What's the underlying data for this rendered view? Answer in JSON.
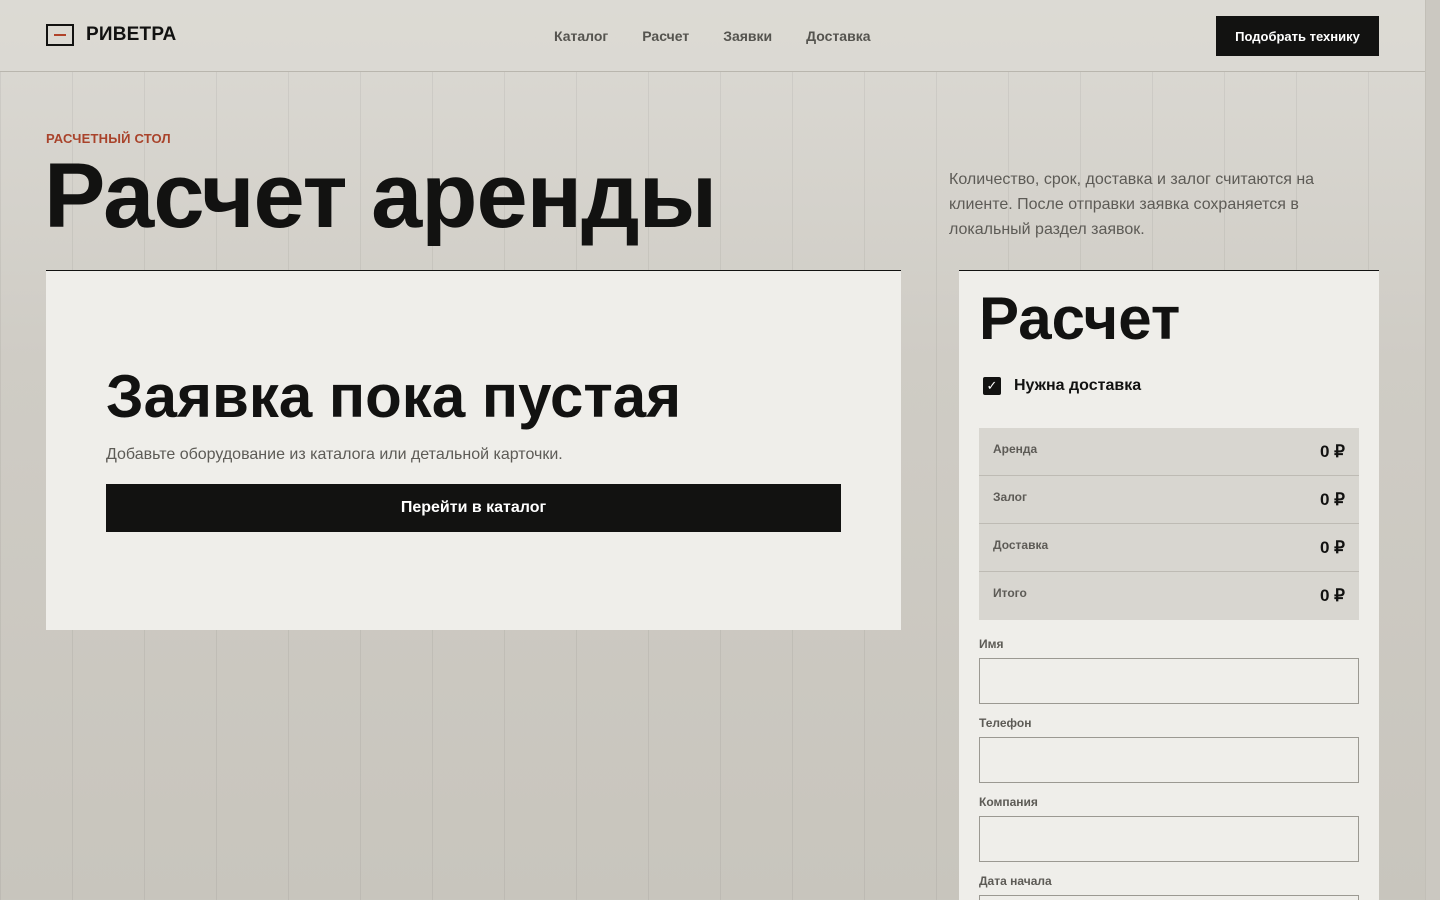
{
  "header": {
    "brand": "РИВЕТРА",
    "nav": [
      "Каталог",
      "Расчет",
      "Заявки",
      "Доставка"
    ],
    "cta_label": "Подобрать технику"
  },
  "hero": {
    "eyebrow": "РАСЧЕТНЫЙ СТОЛ",
    "title": "Расчет аренды",
    "description": "Количество, срок, доставка и залог считаются на клиенте. После отправки заявка сохраняется в локальный раздел заявок."
  },
  "empty_state": {
    "title": "Заявка пока пустая",
    "text": "Добавьте оборудование из каталога или детальной карточки.",
    "button_label": "Перейти в каталог"
  },
  "calculator": {
    "title": "Расчет",
    "delivery_label": "Нужна доставка",
    "delivery_checked": true,
    "summary": [
      {
        "label": "Аренда",
        "value": "0 ₽"
      },
      {
        "label": "Залог",
        "value": "0 ₽"
      },
      {
        "label": "Доставка",
        "value": "0 ₽"
      },
      {
        "label": "Итого",
        "value": "0 ₽"
      }
    ],
    "fields": {
      "name_label": "Имя",
      "name_value": "",
      "phone_label": "Телефон",
      "phone_value": "",
      "company_label": "Компания",
      "company_value": "",
      "start_date_label": "Дата начала",
      "start_date_value": ""
    }
  },
  "colors": {
    "accent": "#a9432b",
    "ink": "#121211",
    "panel": "#efeeea"
  }
}
